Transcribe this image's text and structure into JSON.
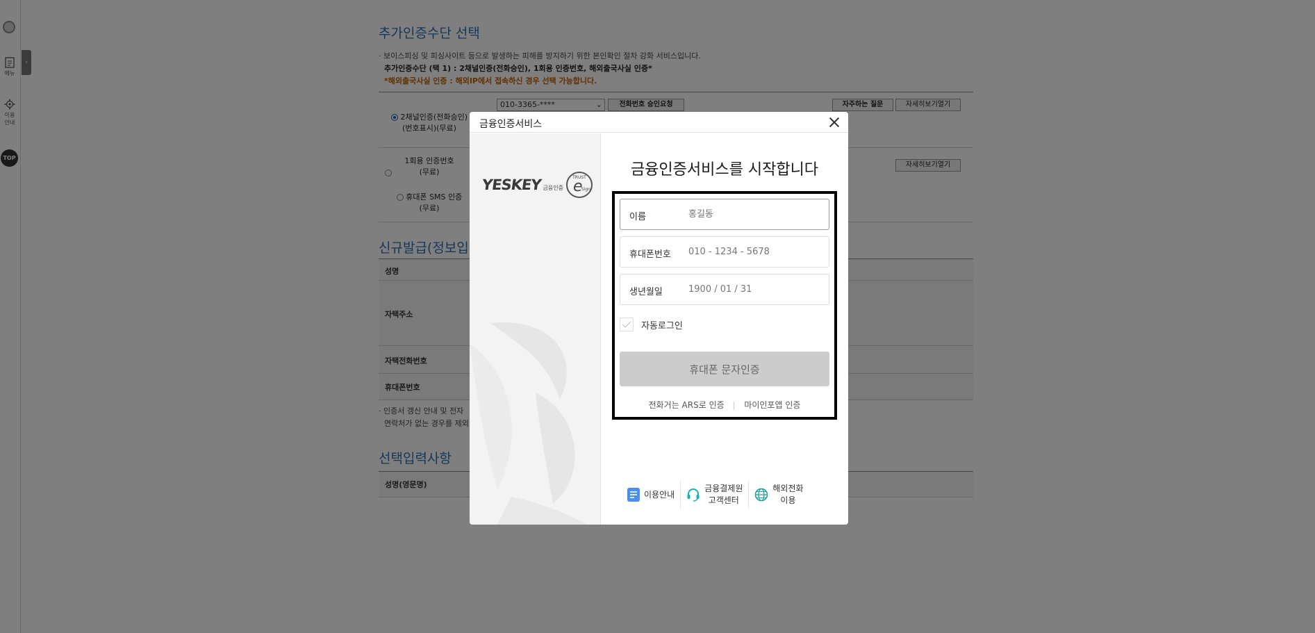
{
  "rail": {
    "menu_label": "메뉴",
    "guide_label_1": "이용",
    "guide_label_2": "안내",
    "top_label": "TOP",
    "toggle_glyph": "›"
  },
  "page": {
    "section1_title": "추가인증수단 선택",
    "note1": "· 보이스피싱 및 피싱사이트 등으로 발생하는 피해를 방지하기 위한 본인확인 절차 강화 서비스입니다.",
    "note2": "추가인증수단 (택 1) : 2채널인증(전화승인), 1회용 인증번호, 해외출국사실 인증*",
    "note3": "*해외출국사실 인증 : 해외IP에서 접속하신 경우 선택 가능합니다.",
    "opt1_line1": "2채널인증(전화승인)",
    "opt1_line2": "(번호표시)(무료)",
    "opt2_line1": "1회용 인증번호",
    "opt2_line2": "(무료)",
    "opt3_line1": "휴대폰 SMS 인증",
    "opt3_line2": "(무료)",
    "phone_select": "010-3365-****",
    "phone_request_btn": "전화번호 승인요청",
    "faq_btn": "자주하는 질문",
    "detail_btn_1": "자세히보기열기",
    "detail_btn_2": "자세히보기열기",
    "section2_title": "신규발급(정보입",
    "row_name": "성명",
    "row_address": "자택주소",
    "row_home_phone": "자택전화번호",
    "row_mobile": "휴대폰번호",
    "note4": "· 인증서 갱신 안내 및 전자",
    "note5": "연락처가 없는 경우를 제외",
    "section3_title": "선택입력사항",
    "row_eng_name": "성명(영문명)"
  },
  "modal": {
    "title": "금융인증서비스",
    "brand_word": "YESKEY",
    "brand_sub": "금융인증",
    "esign_top": "TRUST",
    "esign_e": "e",
    "esign_side": "Sign",
    "heading": "금융인증서비스를 시작합니다",
    "fields": [
      {
        "label": "이름",
        "placeholder": "홍길동"
      },
      {
        "label": "휴대폰번호",
        "placeholder": "010 - 1234 - 5678"
      },
      {
        "label": "생년월일",
        "placeholder": "1900 / 01 / 31"
      }
    ],
    "auto_login": "자동로그인",
    "sms_button": "휴대폰 문자인증",
    "ars_link": "전화거는 ARS로 인증",
    "myinfo_link": "마이인포앱 인증",
    "footer": {
      "guide": "이용안내",
      "center_line1": "금융결제원",
      "center_line2": "고객센터",
      "overseas_line1": "해외전화",
      "overseas_line2": "이용"
    }
  },
  "colors": {
    "title_blue": "#2f6fb3",
    "warn_orange": "#c06000",
    "guide_icon_blue": "#4a8ef0",
    "headset_teal": "#17b3b3",
    "globe_teal": "#1fa3a3"
  }
}
